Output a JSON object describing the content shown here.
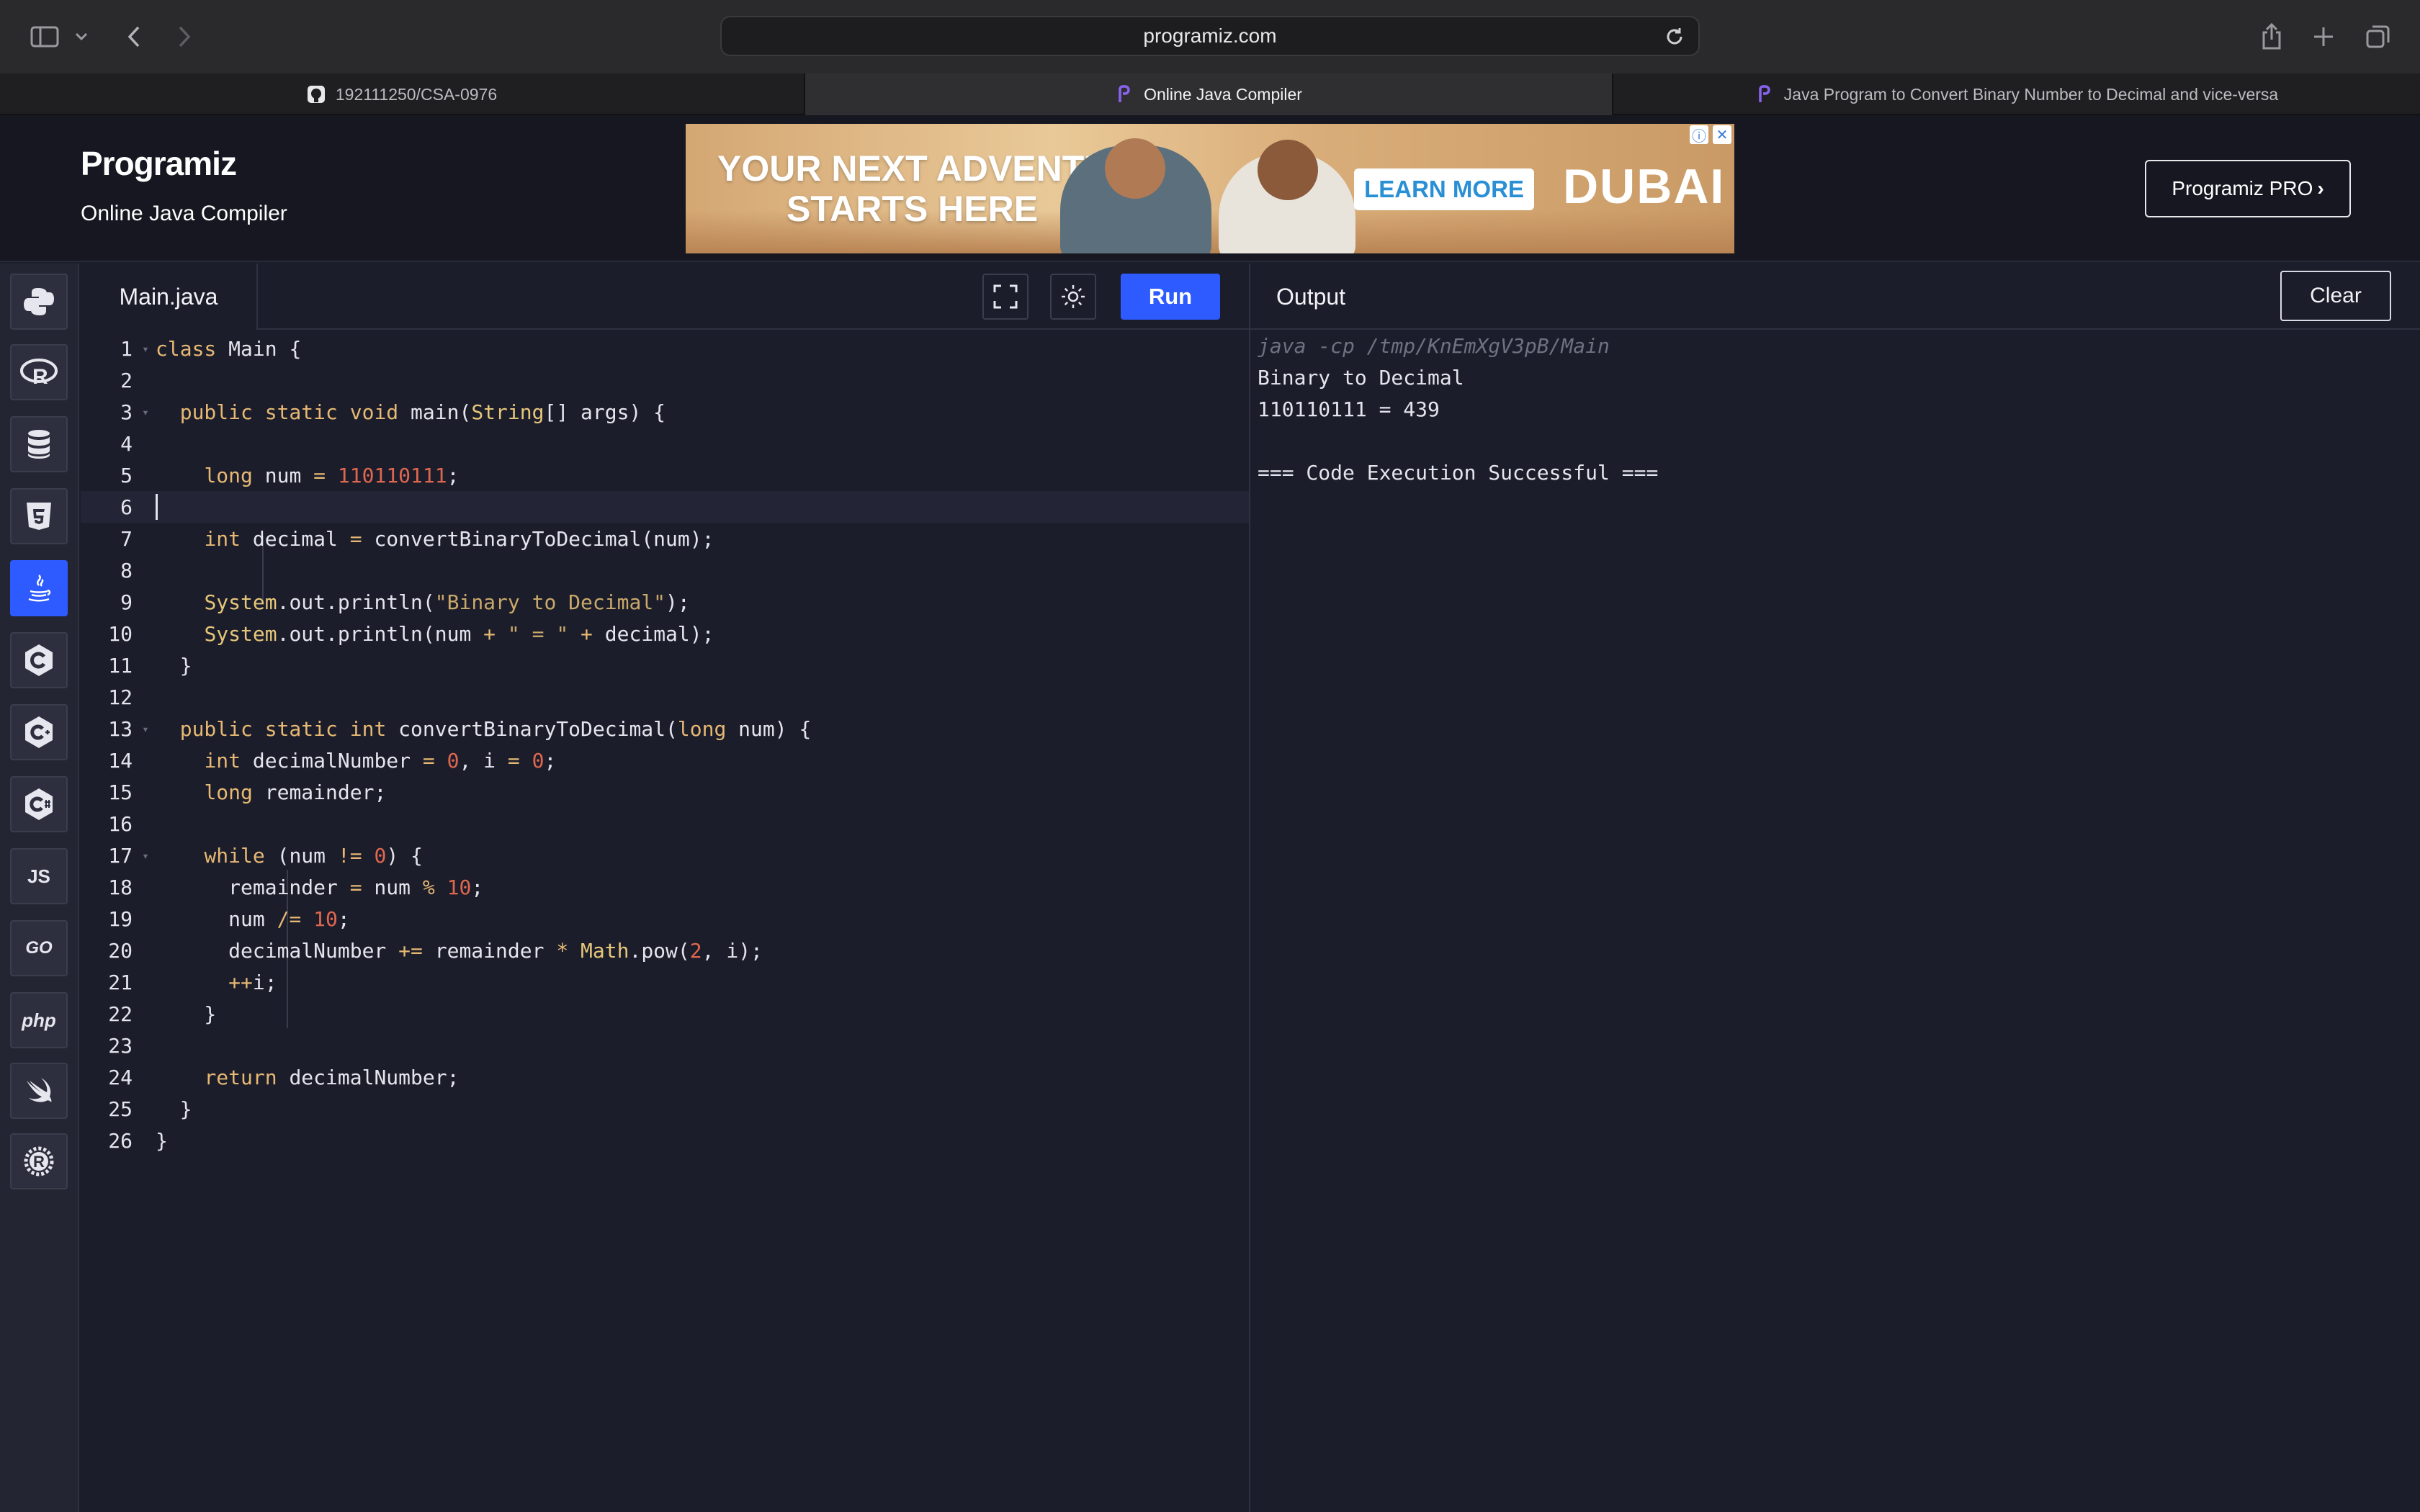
{
  "browser": {
    "url": "programiz.com",
    "tabs": [
      {
        "label": "192111250/CSA-0976",
        "icon": "github-icon"
      },
      {
        "label": "Online Java Compiler",
        "icon": "programiz-icon"
      },
      {
        "label": "Java Program to Convert Binary Number to Decimal and vice-versa",
        "icon": "programiz-icon"
      }
    ]
  },
  "header": {
    "logo": "Programiz",
    "subtitle": "Online Java Compiler",
    "pro_button": "Programiz PRO",
    "ad": {
      "headline_1": "YOUR NEXT ADVENTURE",
      "headline_2": "STARTS HERE",
      "cta": "LEARN MORE",
      "brand": "DUBAI"
    }
  },
  "languages": [
    {
      "name": "python-icon",
      "label": ""
    },
    {
      "name": "r-icon",
      "label": ""
    },
    {
      "name": "sql-icon",
      "label": ""
    },
    {
      "name": "html-icon",
      "label": ""
    },
    {
      "name": "java-icon",
      "label": "",
      "active": true
    },
    {
      "name": "c-icon",
      "label": ""
    },
    {
      "name": "cpp-icon",
      "label": ""
    },
    {
      "name": "csharp-icon",
      "label": ""
    },
    {
      "name": "javascript-icon",
      "label": "JS"
    },
    {
      "name": "go-icon",
      "label": "GO"
    },
    {
      "name": "php-icon",
      "label": "php"
    },
    {
      "name": "swift-icon",
      "label": ""
    },
    {
      "name": "rust-icon",
      "label": ""
    }
  ],
  "editor": {
    "filename": "Main.java",
    "run_label": "Run",
    "current_line": 6,
    "lines": [
      {
        "n": "1",
        "fold": true,
        "html": "<span class=\"kw\">class</span> Main {"
      },
      {
        "n": "2",
        "html": ""
      },
      {
        "n": "3",
        "fold": true,
        "html": "  <span class=\"kw\">public static void</span> main(<span class=\"cls\">String</span>[] args) {"
      },
      {
        "n": "4",
        "html": ""
      },
      {
        "n": "5",
        "html": "    <span class=\"kw\">long</span> num <span class=\"op\">=</span> <span class=\"num\">110110111</span>;"
      },
      {
        "n": "6",
        "html": ""
      },
      {
        "n": "7",
        "html": "    <span class=\"kw\">int</span> decimal <span class=\"op\">=</span> convertBinaryToDecimal(num);"
      },
      {
        "n": "8",
        "html": ""
      },
      {
        "n": "9",
        "html": "    <span class=\"cls\">System</span>.out.println(<span class=\"str\">\"Binary to Decimal\"</span>);"
      },
      {
        "n": "10",
        "html": "    <span class=\"cls\">System</span>.out.println(num <span class=\"op\">+</span> <span class=\"str\">\" = \"</span> <span class=\"op\">+</span> decimal);"
      },
      {
        "n": "11",
        "html": "  }"
      },
      {
        "n": "12",
        "html": ""
      },
      {
        "n": "13",
        "fold": true,
        "html": "  <span class=\"kw\">public static int</span> convertBinaryToDecimal(<span class=\"kw\">long</span> num) {"
      },
      {
        "n": "14",
        "html": "    <span class=\"kw\">int</span> decimalNumber <span class=\"op\">=</span> <span class=\"num\">0</span>, i <span class=\"op\">=</span> <span class=\"num\">0</span>;"
      },
      {
        "n": "15",
        "html": "    <span class=\"kw\">long</span> remainder;"
      },
      {
        "n": "16",
        "html": ""
      },
      {
        "n": "17",
        "fold": true,
        "html": "    <span class=\"kw\">while</span> (num <span class=\"op\">!=</span> <span class=\"num\">0</span>) {"
      },
      {
        "n": "18",
        "html": "      remainder <span class=\"op\">=</span> num <span class=\"op\">%</span> <span class=\"num\">10</span>;"
      },
      {
        "n": "19",
        "html": "      num <span class=\"op\">/=</span> <span class=\"num\">10</span>;"
      },
      {
        "n": "20",
        "html": "      decimalNumber <span class=\"op\">+=</span> remainder <span class=\"op\">*</span> <span class=\"cls\">Math</span>.pow(<span class=\"num\">2</span>, i);"
      },
      {
        "n": "21",
        "html": "      <span class=\"op\">++</span>i;"
      },
      {
        "n": "22",
        "html": "    }"
      },
      {
        "n": "23",
        "html": ""
      },
      {
        "n": "24",
        "html": "    <span class=\"kw\">return</span> decimalNumber;"
      },
      {
        "n": "25",
        "html": "  }"
      },
      {
        "n": "26",
        "html": "}"
      }
    ]
  },
  "output": {
    "title": "Output",
    "clear_label": "Clear",
    "command": "java -cp /tmp/KnEmXgV3pB/Main",
    "lines": [
      "Binary to Decimal",
      "110110111 = 439",
      "",
      "=== Code Execution Successful ==="
    ]
  }
}
